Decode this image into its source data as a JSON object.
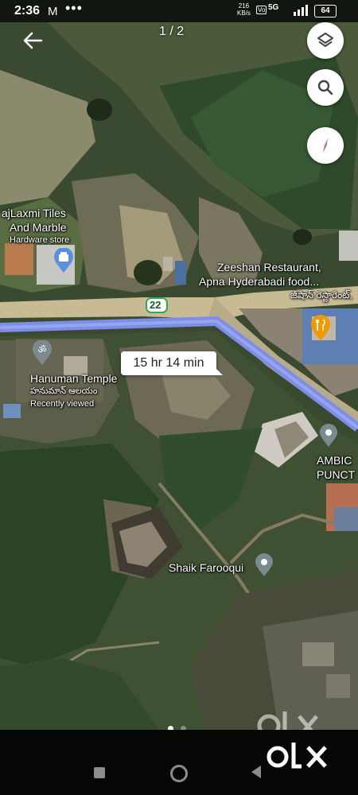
{
  "status_bar": {
    "time": "2:36",
    "gmail": "M",
    "dots": "•••",
    "speed_value": "216",
    "speed_unit": "KB/s",
    "volte": "Vo",
    "network": "5G",
    "battery": "64"
  },
  "header": {
    "page_counter": "1 / 2"
  },
  "map": {
    "road_number": "22",
    "route_time": "15 hr 14 min",
    "places": {
      "rajlaxmi_line1": "ajLaxmi Tiles",
      "rajlaxmi_line2": "And Marble",
      "rajlaxmi_category": "Hardware store",
      "zeeshan_line1": "Zeeshan Restaurant,",
      "zeeshan_line2": "Apna Hyderabadi food...",
      "zeeshan_telugu": "జీషాన్ రెస్టారెంట్,",
      "hanuman_name": "Hanuman Temple",
      "hanuman_telugu": "హనుమాన్ ఆలయం",
      "hanuman_status": "Recently viewed",
      "ambica_line1": "AMBIC",
      "ambica_line2": "PUNCT",
      "shaik": "Shaik Farooqui"
    }
  },
  "icons": {
    "back": "back-arrow-icon",
    "layers": "layers-icon",
    "search": "search-icon",
    "compass": "compass-icon"
  },
  "colors": {
    "route": "#7d8ee8",
    "pin_blue": "#5b8fe0",
    "pin_orange": "#f29900",
    "pin_grey": "#7b8a8f"
  },
  "pager": {
    "active_index": 1,
    "count": 2
  },
  "watermark": "OLX",
  "brand": {
    "logo": "olx"
  }
}
